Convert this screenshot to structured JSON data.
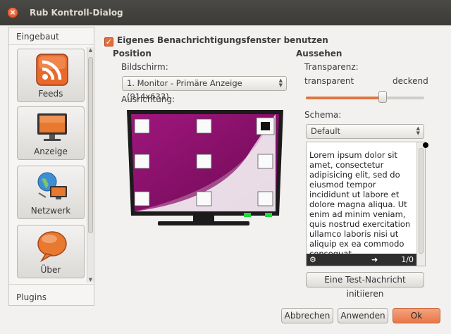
{
  "window": {
    "title": "Rub Kontroll-Dialog",
    "close_glyph": "×"
  },
  "sidebar": {
    "header": "Eingebaut",
    "items": [
      {
        "label": "Feeds",
        "icon": "rss-feed-icon"
      },
      {
        "label": "Anzeige",
        "icon": "monitor-icon"
      },
      {
        "label": "Netzwerk",
        "icon": "network-icon"
      },
      {
        "label": "Über",
        "icon": "speech-bubble-icon"
      }
    ],
    "footer": "Plugins"
  },
  "main": {
    "own_window_checkbox": {
      "label": "Eigenes Benachrichtigungsfenster benutzen",
      "checked": true,
      "check_glyph": "✓"
    },
    "position": {
      "title": "Position",
      "screen_label": "Bildschirm:",
      "screen_value": "1. Monitor - Primäre Anzeige (914x633)",
      "alignment_label": "Ausrichtung:"
    },
    "appearance": {
      "title": "Aussehen",
      "transparency_label": "Transparenz:",
      "transparent_label": "transparent",
      "opaque_label": "deckend",
      "transparency_level": 0.65,
      "scheme_label": "Schema:",
      "scheme_value": "Default",
      "preview_text": "Lorem ipsum dolor sit amet, consectetur adipisicing elit, sed do eiusmod tempor incididunt ut labore et dolore magna aliqua. Ut enim ad minim veniam, quis nostrud exercitation ullamco laboris nisi ut aliquip ex ea commodo consequat.",
      "preview_page": "1/0",
      "test_button": "Eine Test-Nachricht initiieren"
    }
  },
  "footer": {
    "cancel": "Abbrechen",
    "apply": "Anwenden",
    "ok": "Ok"
  },
  "colors": {
    "accent": "#e07540",
    "monitor_screen": "#8e0f6e",
    "indicator_green": "#1fdc3a"
  }
}
